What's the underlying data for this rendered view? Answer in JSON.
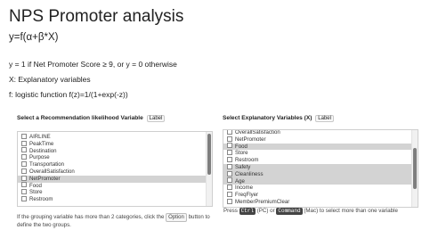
{
  "title": "NPS Promoter analysis",
  "formula": "y=f(α+β*X)",
  "lines": {
    "y_def": "y = 1 if Net Promoter Score ≥ 9, or y = 0 otherwise",
    "x_def": "X: Explanatory variables",
    "f_def": "f: logistic function f(z)=1/(1+exp(-z))"
  },
  "left_panel": {
    "label": "Select a Recommendation likelihood Variable",
    "tag": "Label",
    "items": [
      {
        "label": "AIRLINE",
        "selected": false
      },
      {
        "label": "PeakTime",
        "selected": false
      },
      {
        "label": "Destination",
        "selected": false
      },
      {
        "label": "Purpose",
        "selected": false
      },
      {
        "label": "Transportation",
        "selected": false
      },
      {
        "label": "OverallSatisfaction",
        "selected": false
      },
      {
        "label": "NetPromoter",
        "selected": true
      },
      {
        "label": "Food",
        "selected": false
      },
      {
        "label": "Store",
        "selected": false
      },
      {
        "label": "Restroom",
        "selected": false
      }
    ],
    "note_pre": "If the grouping variable has more than 2 categories, click the",
    "note_btn": "Option",
    "note_post": "button to",
    "note_line2": "define the two groups."
  },
  "right_panel": {
    "label": "Select Explanatory Variables (X)",
    "tag": "Label",
    "items": [
      {
        "label": "OverallSatisfaction",
        "selected": false
      },
      {
        "label": "NetPromoter",
        "selected": false
      },
      {
        "label": "Food",
        "selected": true
      },
      {
        "label": "Store",
        "selected": false
      },
      {
        "label": "Restroom",
        "selected": false
      },
      {
        "label": "Safety",
        "selected": true
      },
      {
        "label": "Cleanliness",
        "selected": true
      },
      {
        "label": "Age",
        "selected": true
      },
      {
        "label": "Income",
        "selected": false
      },
      {
        "label": "FreqFlyer",
        "selected": false
      },
      {
        "label": "MemberPremiumClear",
        "selected": false
      }
    ],
    "hint_pre": "Press",
    "hint_key1": "Ctrl",
    "hint_mid": "(PC) or",
    "hint_key2": "Command",
    "hint_post": "(Mac) to select more than one variable"
  }
}
